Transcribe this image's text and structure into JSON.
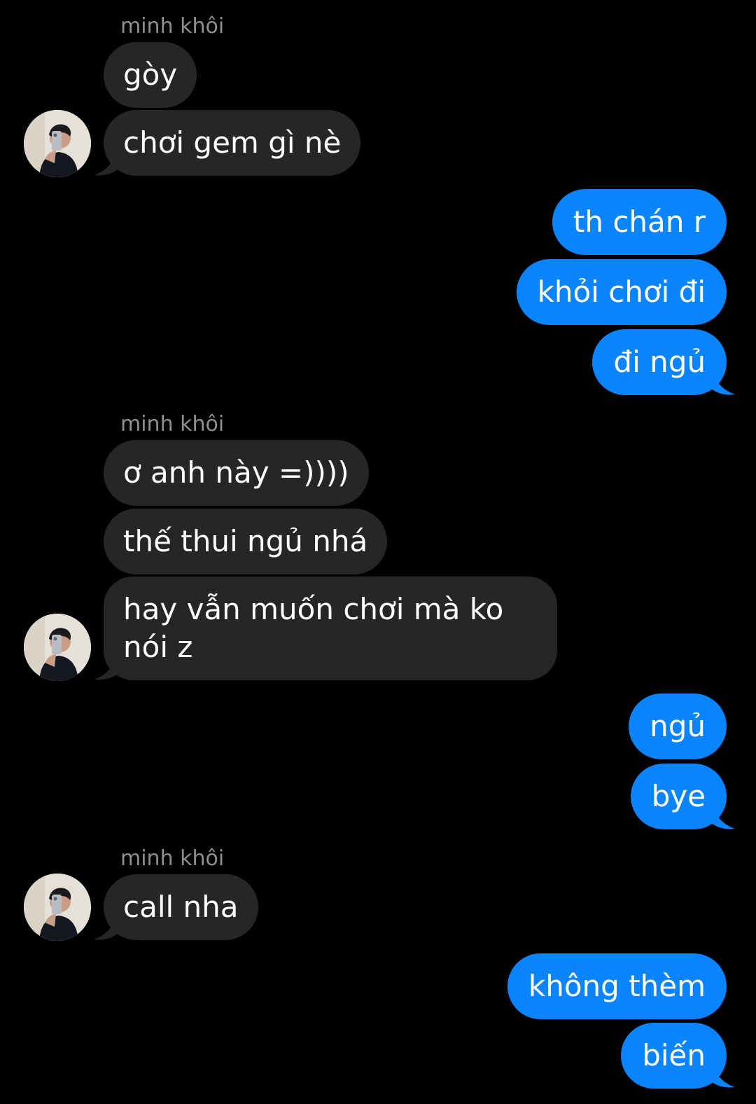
{
  "conversation": {
    "contact_name": "minh khôi",
    "groups": [
      {
        "sender_label": "minh khôi",
        "messages": [
          "gòy",
          "chơi gem gì nè"
        ]
      },
      {
        "messages": [
          "th chán r",
          "khỏi chơi đi",
          "đi ngủ"
        ]
      },
      {
        "sender_label": "minh khôi",
        "messages": [
          "ơ anh này =))))",
          "thế thui ngủ nhá",
          "hay vẫn muốn chơi mà ko nói z"
        ]
      },
      {
        "messages": [
          "ngủ",
          "bye"
        ]
      },
      {
        "sender_label": "minh khôi",
        "messages": [
          "call nha"
        ]
      },
      {
        "messages": [
          "không thèm",
          "biến"
        ]
      }
    ]
  },
  "theme": {
    "background": "#000000",
    "incoming_bubble": "#262628",
    "outgoing_bubble": "#0a84ff",
    "sender_label_color": "#8e8e93"
  },
  "icons": {
    "avatar": "contact-avatar-photo"
  }
}
